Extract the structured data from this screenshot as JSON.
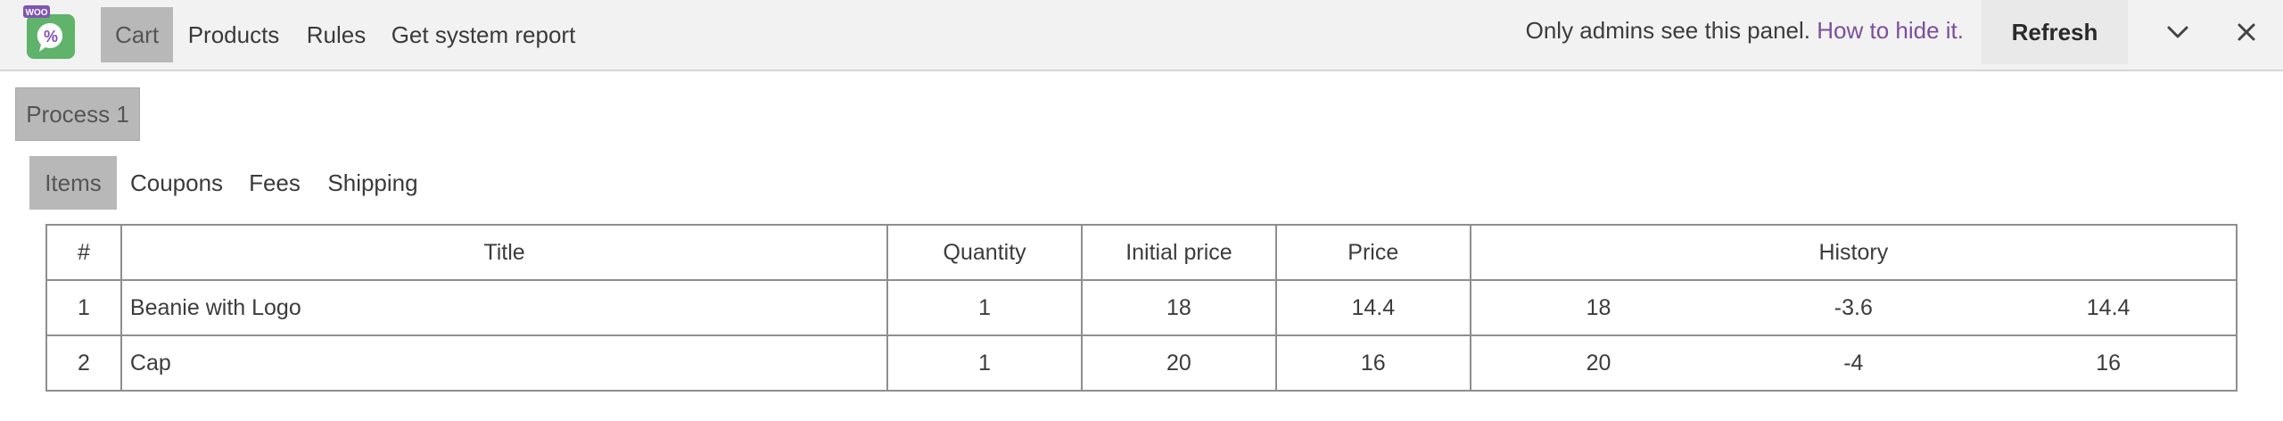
{
  "topbar": {
    "logo_text": "WOO",
    "nav": [
      {
        "label": "Cart",
        "active": true
      },
      {
        "label": "Products",
        "active": false
      },
      {
        "label": "Rules",
        "active": false
      },
      {
        "label": "Get system report",
        "active": false
      }
    ],
    "notice_text": "Only admins see this panel.",
    "notice_link": "How to hide it.",
    "refresh_label": "Refresh",
    "collapse_icon": "chevron-down-icon",
    "close_icon": "close-icon"
  },
  "process_tab": "Process 1",
  "sub_tabs": [
    {
      "label": "Items",
      "active": true
    },
    {
      "label": "Coupons",
      "active": false
    },
    {
      "label": "Fees",
      "active": false
    },
    {
      "label": "Shipping",
      "active": false
    }
  ],
  "table": {
    "headers": [
      "#",
      "Title",
      "Quantity",
      "Initial price",
      "Price",
      "History"
    ],
    "rows": [
      {
        "num": "1",
        "title": "Beanie with Logo",
        "quantity": "1",
        "initial_price": "18",
        "price": "14.4",
        "history": [
          "18",
          "-3.6",
          "14.4"
        ]
      },
      {
        "num": "2",
        "title": "Cap",
        "quantity": "1",
        "initial_price": "20",
        "price": "16",
        "history": [
          "20",
          "-4",
          "16"
        ]
      }
    ]
  },
  "colors": {
    "link": "#7b4f9a",
    "logo_green": "#5fb36b",
    "logo_purple": "#7f54b3",
    "active_tab": "#b8b8b8"
  }
}
